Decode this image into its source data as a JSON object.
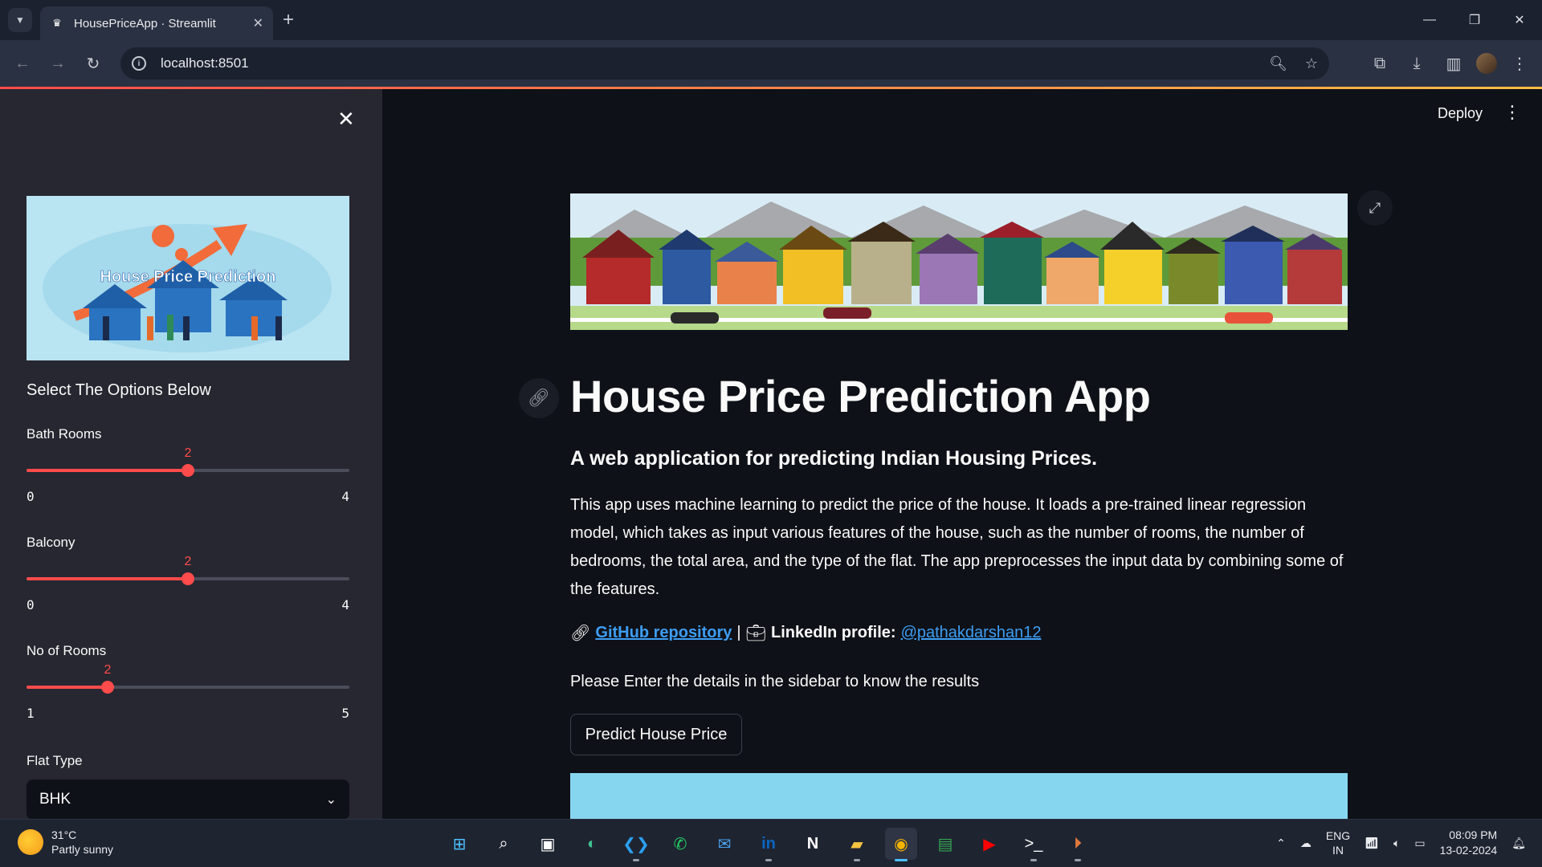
{
  "browser": {
    "tab_title": "HousePriceApp · Streamlit",
    "url": "localhost:8501"
  },
  "sidebar": {
    "heading": "Select The Options Below",
    "image_text": "House Price Prediction",
    "sliders": [
      {
        "label": "Bath Rooms",
        "value": "2",
        "min": "0",
        "max": "4",
        "fraction": 0.5
      },
      {
        "label": "Balcony",
        "value": "2",
        "min": "0",
        "max": "4",
        "fraction": 0.5
      },
      {
        "label": "No of Rooms",
        "value": "2",
        "min": "1",
        "max": "5",
        "fraction": 0.25
      }
    ],
    "flat_type": {
      "label": "Flat Type",
      "value": "BHK"
    }
  },
  "header": {
    "deploy_label": "Deploy"
  },
  "main": {
    "title": "House Price Prediction App",
    "subtitle": "A web application for predicting Indian Housing Prices.",
    "description": "This app uses machine learning to predict the price of the house. It loads a pre-trained linear regression model, which takes as input various features of the house, such as the number of rooms, the number of bedrooms, the total area, and the type of the flat. The app preprocesses the input data by combining some of the features.",
    "links": {
      "github_label": "GitHub repository",
      "separator": "|",
      "linkedin_prefix": "LinkedIn profile:",
      "linkedin_handle": "@pathakdarshan12"
    },
    "instruction": "Please Enter the details in the sidebar to know the results",
    "predict_button": "Predict House Price"
  },
  "taskbar": {
    "weather_temp": "31°C",
    "weather_desc": "Partly sunny",
    "lang_top": "ENG",
    "lang_bottom": "IN",
    "time": "08:09 PM",
    "date": "13-02-2024"
  },
  "colors": {
    "accent": "#ff4b4b",
    "link": "#3d9df3",
    "sidebar_bg": "#262730",
    "main_bg": "#0e1117"
  }
}
